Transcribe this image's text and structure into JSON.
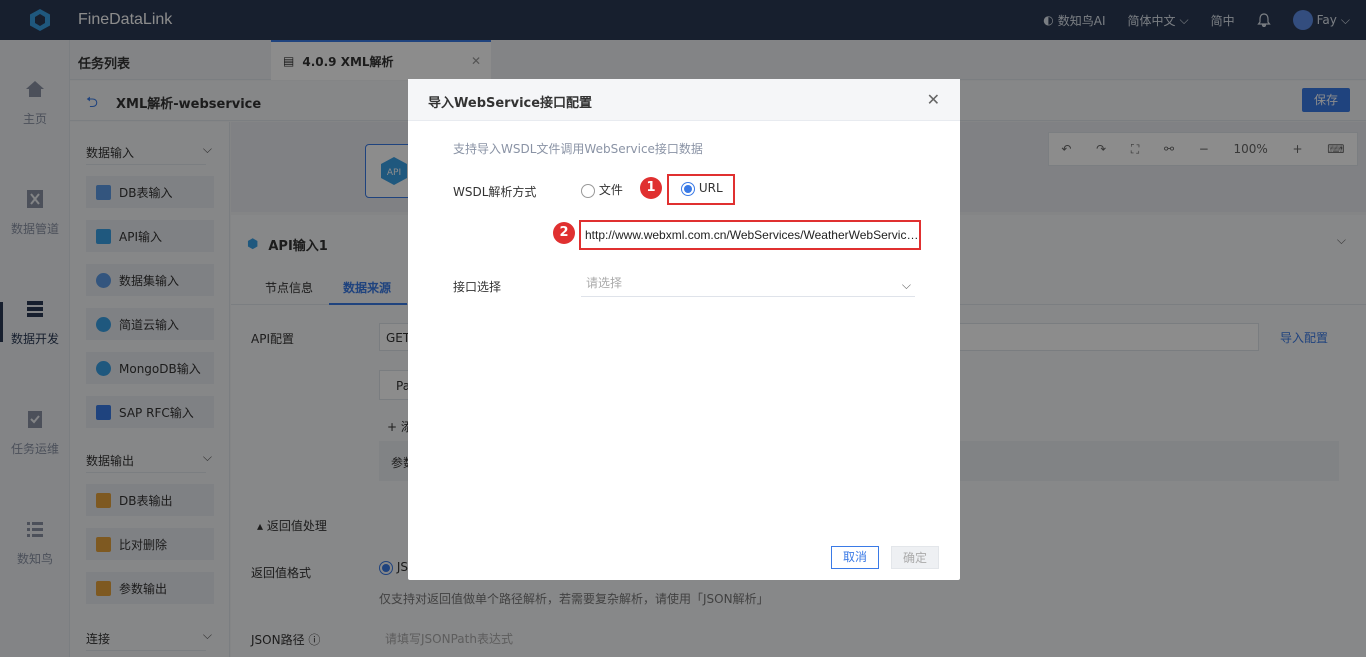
{
  "app": {
    "name": "FineDataLink",
    "brand_color": "#2b3a55",
    "accent_color": "#3a7ae6"
  },
  "topbar": {
    "ai_label": "数知鸟AI",
    "language": "简体中文",
    "simple": "简中",
    "user": "Fay"
  },
  "leftnav": {
    "items": [
      {
        "label": "主页",
        "icon": "home-icon"
      },
      {
        "label": "数据管道",
        "icon": "pipeline-icon"
      },
      {
        "label": "数据开发",
        "icon": "dev-icon"
      },
      {
        "label": "任务运维",
        "icon": "ops-icon"
      },
      {
        "label": "数知鸟",
        "icon": "list-icon"
      }
    ]
  },
  "tasklist": {
    "title": "任务列表"
  },
  "tab": {
    "label": "4.0.9 XML解析"
  },
  "flow": {
    "name": "XML解析-webservice",
    "save_label": "保存"
  },
  "sidebar": {
    "groups": [
      {
        "label": "数据输入"
      },
      {
        "label": "数据输出"
      },
      {
        "label": "连接"
      }
    ],
    "input_items": [
      "DB表输入",
      "API输入",
      "数据集输入",
      "简道云输入",
      "MongoDB输入",
      "SAP RFC输入"
    ],
    "output_items": [
      "DB表输出",
      "比对删除",
      "参数输出"
    ]
  },
  "canvas": {
    "zoom": "100%"
  },
  "bottom": {
    "title": "API输入1",
    "tabs": [
      "节点信息",
      "数据来源"
    ],
    "api_label": "API配置",
    "method": "GET",
    "import_label": "导入配置",
    "pa": "Pa",
    "add": "+",
    "add_text": "添",
    "params": "参数",
    "return_section": "返回值处理",
    "return_format_label": "返回值格式",
    "return_format_value": "JS",
    "return_note": "仅支持对返回值做单个路径解析，若需要复杂解析，请使用「JSON解析」",
    "json_path_label": "JSON路径",
    "json_path_placeholder": "请填写JSONPath表达式"
  },
  "dialog": {
    "title": "导入WebService接口配置",
    "description": "支持导入WSDL文件调用WebService接口数据",
    "wsdl_label": "WSDL解析方式",
    "options": [
      {
        "label": "文件",
        "selected": false
      },
      {
        "label": "URL",
        "selected": true
      }
    ],
    "url_value": "http://www.webxml.com.cn/WebServices/WeatherWebService.asmx?wsdl",
    "interface_label": "接口选择",
    "interface_placeholder": "请选择",
    "cancel_label": "取消",
    "ok_label": "确定",
    "badges": [
      "1",
      "2"
    ]
  }
}
